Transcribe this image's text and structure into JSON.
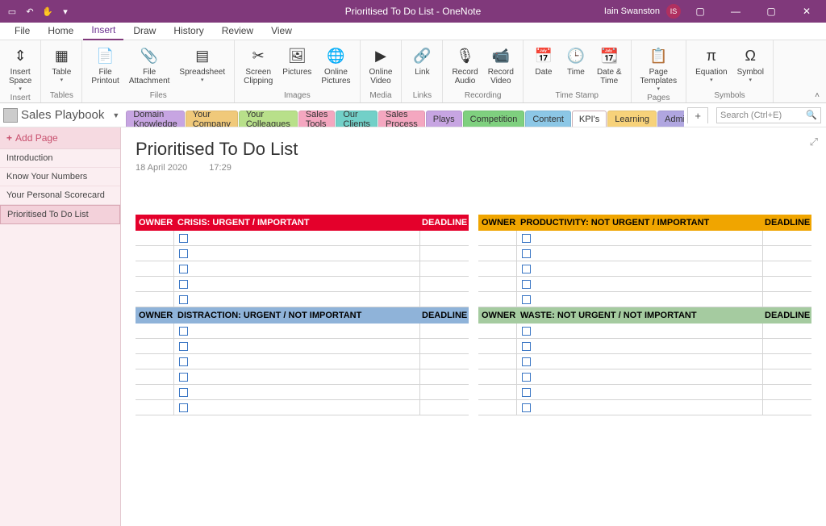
{
  "titleBar": {
    "appTitle": "Prioritised To Do List  -  OneNote",
    "userName": "Iain Swanston",
    "userInitials": "IS"
  },
  "menuTabs": [
    "File",
    "Home",
    "Insert",
    "Draw",
    "History",
    "Review",
    "View"
  ],
  "activeMenuTab": "Insert",
  "ribbon": {
    "groups": [
      {
        "label": "Insert",
        "items": [
          {
            "caption": "Insert Space",
            "drop": true,
            "icon": "insert-space"
          }
        ]
      },
      {
        "label": "Tables",
        "items": [
          {
            "caption": "Table",
            "drop": true,
            "icon": "table"
          }
        ]
      },
      {
        "label": "Files",
        "items": [
          {
            "caption": "File Printout",
            "icon": "file-printout"
          },
          {
            "caption": "File Attachment",
            "icon": "attachment"
          },
          {
            "caption": "Spreadsheet",
            "drop": true,
            "icon": "spreadsheet"
          }
        ]
      },
      {
        "label": "Images",
        "items": [
          {
            "caption": "Screen Clipping",
            "icon": "screen-clipping"
          },
          {
            "caption": "Pictures",
            "icon": "pictures"
          },
          {
            "caption": "Online Pictures",
            "icon": "online-pictures"
          }
        ]
      },
      {
        "label": "Media",
        "items": [
          {
            "caption": "Online Video",
            "icon": "online-video"
          }
        ]
      },
      {
        "label": "Links",
        "items": [
          {
            "caption": "Link",
            "icon": "link"
          }
        ]
      },
      {
        "label": "Recording",
        "items": [
          {
            "caption": "Record Audio",
            "icon": "record-audio"
          },
          {
            "caption": "Record Video",
            "icon": "record-video"
          }
        ]
      },
      {
        "label": "Time Stamp",
        "items": [
          {
            "caption": "Date",
            "icon": "date"
          },
          {
            "caption": "Time",
            "icon": "time"
          },
          {
            "caption": "Date & Time",
            "icon": "date-time"
          }
        ]
      },
      {
        "label": "Pages",
        "items": [
          {
            "caption": "Page Templates",
            "drop": true,
            "icon": "page-templates"
          }
        ]
      },
      {
        "label": "Symbols",
        "items": [
          {
            "caption": "Equation",
            "drop": true,
            "icon": "equation"
          },
          {
            "caption": "Symbol",
            "drop": true,
            "icon": "symbol"
          }
        ]
      }
    ]
  },
  "notebook": {
    "name": "Sales Playbook",
    "sections": [
      {
        "name": "Domain Knowledge",
        "color": "#c7a5e2"
      },
      {
        "name": "Your Company",
        "color": "#f0c97a"
      },
      {
        "name": "Your Colleagues",
        "color": "#b8e08a"
      },
      {
        "name": "Sales Tools",
        "color": "#f4a7c0"
      },
      {
        "name": "Our Clients",
        "color": "#72d0c8"
      },
      {
        "name": "Sales Process",
        "color": "#f4a7c0"
      },
      {
        "name": "Plays",
        "color": "#c7a5e2"
      },
      {
        "name": "Competition",
        "color": "#7fd07f"
      },
      {
        "name": "Content",
        "color": "#8cc7e6"
      },
      {
        "name": "KPI's",
        "color": "#f9c6d0",
        "active": true
      },
      {
        "name": "Learning",
        "color": "#f7d27a"
      },
      {
        "name": "Admin",
        "color": "#b0a6e0"
      }
    ],
    "searchPlaceholder": "Search (Ctrl+E)"
  },
  "pagesPane": {
    "addLabel": "Add Page",
    "pages": [
      "Introduction",
      "Know Your Numbers",
      "Your Personal Scorecard",
      "Prioritised To Do List"
    ],
    "selected": "Prioritised To Do List"
  },
  "page": {
    "title": "Prioritised To Do List",
    "date": "18 April 2020",
    "time": "17:29"
  },
  "quadrants": [
    {
      "key": "crisis",
      "header": "CRISIS: URGENT / IMPORTANT",
      "owner": "OWNER",
      "deadline": "DEADLINE",
      "rows": 5,
      "class": "q-crisis"
    },
    {
      "key": "productivity",
      "header": "PRODUCTIVITY: NOT URGENT / IMPORTANT",
      "owner": "OWNER",
      "deadline": "DEADLINE",
      "rows": 5,
      "class": "q-prod"
    },
    {
      "key": "distraction",
      "header": "DISTRACTION: URGENT / NOT IMPORTANT",
      "owner": "OWNER",
      "deadline": "DEADLINE",
      "rows": 6,
      "class": "q-dist"
    },
    {
      "key": "waste",
      "header": "WASTE: NOT URGENT / NOT IMPORTANT",
      "owner": "OWNER",
      "deadline": "DEADLINE",
      "rows": 6,
      "class": "q-waste"
    }
  ]
}
